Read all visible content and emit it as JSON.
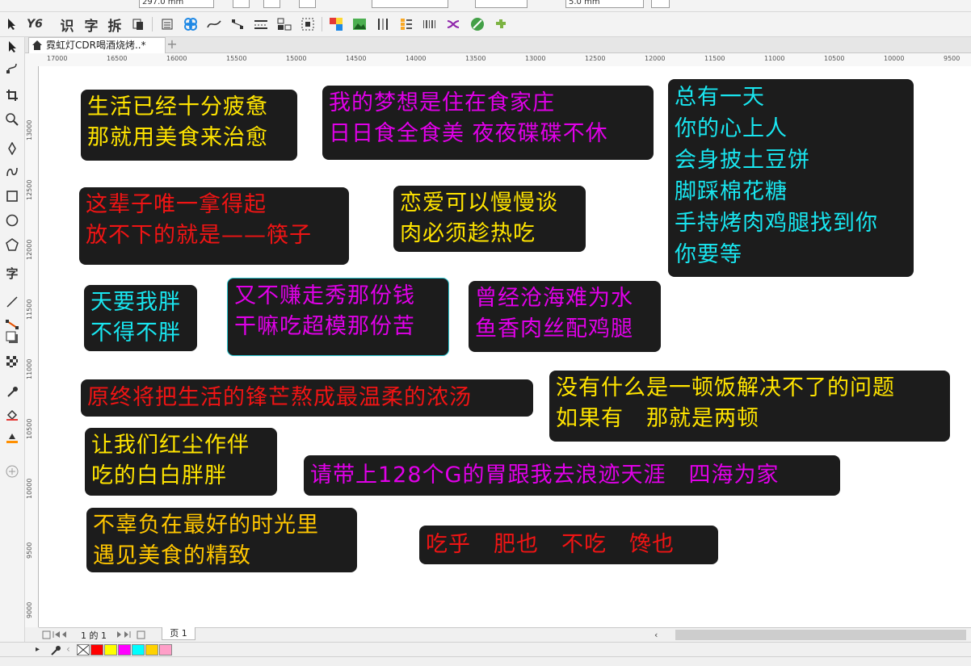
{
  "property_bar": {
    "width_value": "297.0 mm",
    "outline_value": "5.0 mm"
  },
  "toolbar": {
    "text_buttons": [
      "Y6",
      "识",
      "字",
      "拆"
    ]
  },
  "document_tab": {
    "title": "霓虹灯CDR喝酒烧烤..*",
    "add_label": "+"
  },
  "rulers": {
    "horizontal": [
      "17000",
      "16500",
      "16000",
      "15500",
      "15000",
      "14500",
      "14000",
      "13500",
      "13000",
      "12500",
      "12000",
      "11500",
      "11000",
      "10500",
      "10000",
      "9500"
    ],
    "vertical": [
      "13000",
      "12500",
      "12000",
      "11500",
      "11000",
      "10500",
      "10000",
      "9500",
      "9000"
    ]
  },
  "toolbox": {
    "text_tool_label": "字"
  },
  "canvas_boxes": [
    {
      "color": "yellow",
      "lines": [
        "生活已经十分疲惫",
        "那就用美食来治愈"
      ]
    },
    {
      "color": "magenta",
      "lines": [
        "我的梦想是住在食家庄",
        "日日食全食美 夜夜碟碟不休"
      ]
    },
    {
      "color": "cyan",
      "lines": [
        "总有一天",
        "你的心上人",
        "会身披土豆饼",
        "脚踩棉花糖",
        "手持烤肉鸡腿找到你",
        "你要等"
      ]
    },
    {
      "color": "red",
      "lines": [
        "这辈子唯一拿得起",
        "放不下的就是——筷子"
      ]
    },
    {
      "color": "yellow",
      "lines": [
        "恋爱可以慢慢谈",
        "肉必须趁热吃"
      ]
    },
    {
      "color": "cyan",
      "lines": [
        "天要我胖",
        "不得不胖"
      ]
    },
    {
      "color": "magenta",
      "lines": [
        "又不赚走秀那份钱",
        "干嘛吃超模那份苦"
      ]
    },
    {
      "color": "magenta",
      "lines": [
        "曾经沧海难为水",
        "鱼香肉丝配鸡腿"
      ]
    },
    {
      "color": "red",
      "lines": [
        "原终将把生活的锋芒熬成最温柔的浓汤"
      ]
    },
    {
      "color": "yellow",
      "lines": [
        "没有什么是一顿饭解决不了的问题",
        "如果有　那就是两顿"
      ]
    },
    {
      "color": "yellow",
      "lines": [
        "让我们红尘作伴",
        "吃的白白胖胖"
      ]
    },
    {
      "color": "magenta",
      "lines": [
        "请带上128个G的胃跟我去浪迹天涯　四海为家"
      ]
    },
    {
      "color": "orange",
      "lines": [
        "不辜负在最好的时光里",
        "遇见美食的精致"
      ]
    },
    {
      "color": "red",
      "lines": [
        "吃乎　肥也　不吃　馋也"
      ]
    }
  ],
  "page_nav": {
    "page_counter": "1 的 1",
    "page_tab": "页 1"
  },
  "palette": {
    "colors": [
      "#ff0000",
      "#ffff00",
      "#ff00ff",
      "#00ffff",
      "#ffd200",
      "#ff9fc8"
    ]
  },
  "colors": {
    "canvas_box_bg": "#1c1c1c",
    "selection_outline": "#2ac6d0"
  }
}
